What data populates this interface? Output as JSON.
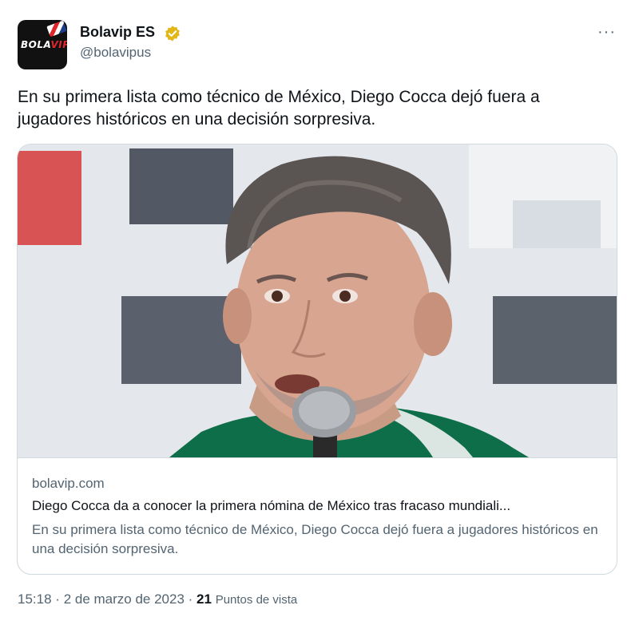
{
  "author": {
    "display_name": "Bolavip ES",
    "handle": "@bolavipus",
    "avatar_text_white": "BOLA",
    "avatar_text_red": "VIP",
    "verified_icon": "verified-badge-gold",
    "verified_color": "#e2b719"
  },
  "tweet": {
    "text": "En su primera lista como técnico de México, Diego Cocca dejó fuera a jugadores históricos en una decisión sorpresiva."
  },
  "card": {
    "image_alt": "Diego Cocca at press conference",
    "domain": "bolavip.com",
    "title": "Diego Cocca da a conocer la primera nómina de México tras fracaso mundiali...",
    "description": "En su primera lista como técnico de México, Diego Cocca dejó fuera a jugadores históricos en una decisión sorpresiva."
  },
  "meta": {
    "time": "15:18",
    "separator": "·",
    "date": "2 de marzo de 2023",
    "views_count": "21",
    "views_label": "Puntos de vista"
  },
  "menu": {
    "more_icon": "more-horizontal-icon"
  }
}
